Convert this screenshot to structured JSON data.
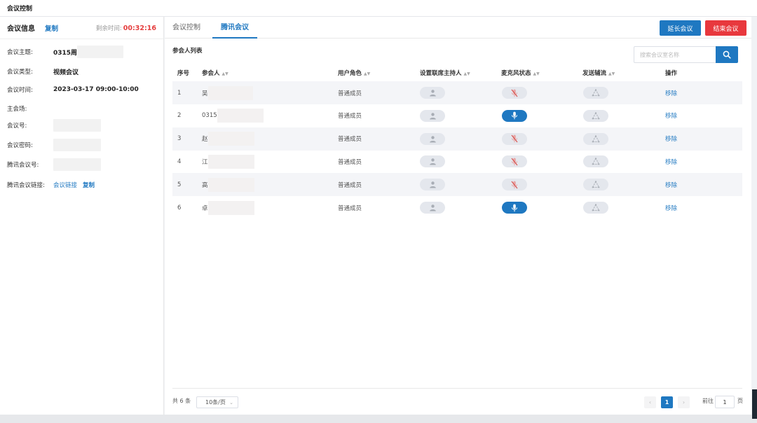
{
  "window": {
    "title": "会议控制"
  },
  "left": {
    "title": "会议信息",
    "copy": "复制",
    "remain_label": "剩余时间:",
    "remain_time": "00:32:16",
    "fields": {
      "subject_k": "会议主题:",
      "subject_v": "0315周",
      "type_k": "会议类型:",
      "type_v": "视频会议",
      "time_k": "会议时间:",
      "time_v": "2023-03-17 09:00-10:00",
      "venue_k": "主会场:",
      "no_k": "会议号:",
      "pwd_k": "会议密码:",
      "tx_no_k": "腾讯会议号:",
      "tx_link_k": "腾讯会议链接:",
      "tx_link_v": "会议链接",
      "tx_link_copy": "复制"
    }
  },
  "tabs": [
    "会议控制",
    "腾讯会议"
  ],
  "actions": {
    "extend": "延长会议",
    "end": "结束会议"
  },
  "list": {
    "title": "参会人列表",
    "search_placeholder": "搜索会议室名称",
    "headers": [
      "序号",
      "参会人",
      "用户角色",
      "设置联席主持人",
      "麦克风状态",
      "发送辅流",
      "操作"
    ],
    "rows": [
      {
        "no": "1",
        "name": "吴",
        "role": "普通成员",
        "mic_on": false,
        "action": "移除"
      },
      {
        "no": "2",
        "name": "0315",
        "role": "普通成员",
        "mic_on": true,
        "action": "移除"
      },
      {
        "no": "3",
        "name": "赵",
        "role": "普通成员",
        "mic_on": false,
        "action": "移除"
      },
      {
        "no": "4",
        "name": "江",
        "role": "普通成员",
        "mic_on": false,
        "action": "移除"
      },
      {
        "no": "5",
        "name": "高",
        "role": "普通成员",
        "mic_on": false,
        "action": "移除"
      },
      {
        "no": "6",
        "name": "卓",
        "role": "普通成员",
        "mic_on": true,
        "action": "移除"
      }
    ]
  },
  "pagination": {
    "total": "共 6 条",
    "page_size": "10条/页",
    "current": "1",
    "prev": "‹",
    "next": "›",
    "goto_prefix": "前往",
    "goto_value": "1",
    "goto_suffix": "页"
  },
  "colors": {
    "accent": "#1f78c1",
    "danger": "#e8383d",
    "timer": "#e53e3e",
    "mic_off": "#d9534f"
  },
  "icons": {
    "search": "search-icon",
    "user": "user-icon",
    "mic": "microphone-icon",
    "mic_off": "microphone-off-icon",
    "share": "share-icon"
  }
}
